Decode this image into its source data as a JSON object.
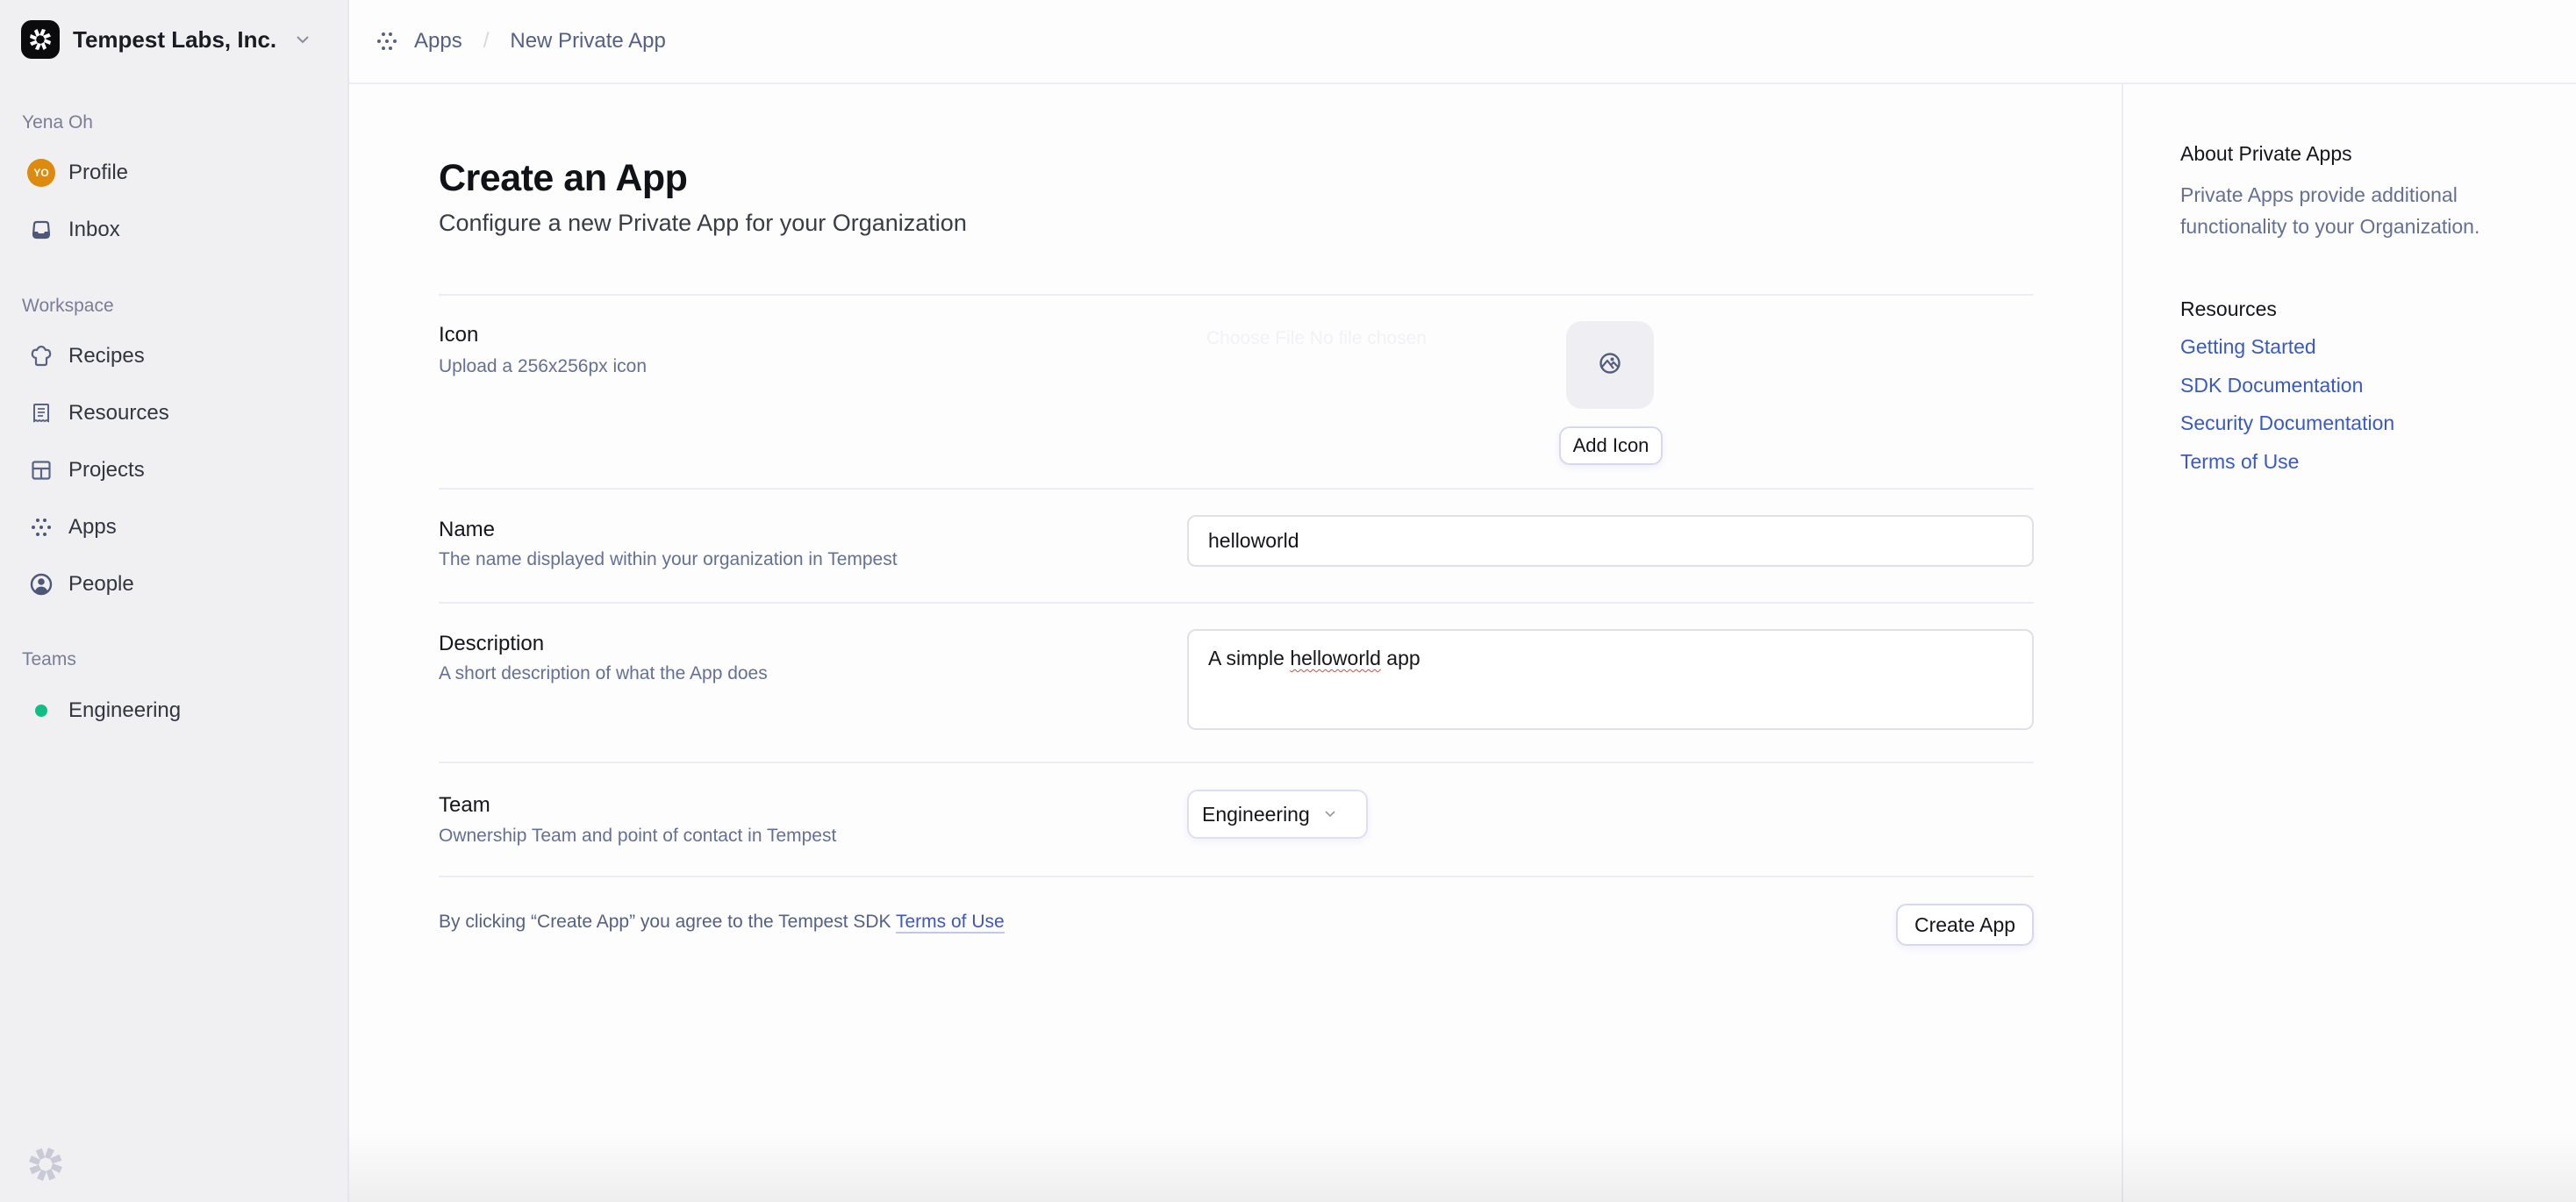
{
  "sidebar": {
    "org_name": "Tempest Labs, Inc.",
    "user_section_label": "Yena Oh",
    "user_items": [
      {
        "label": "Profile",
        "icon": "avatar",
        "avatar_initials": "YO",
        "avatar_color": "#dd8a0d"
      },
      {
        "label": "Inbox",
        "icon": "inbox-icon"
      }
    ],
    "workspace_section_label": "Workspace",
    "workspace_items": [
      {
        "label": "Recipes",
        "icon": "chef-hat-icon"
      },
      {
        "label": "Resources",
        "icon": "receipt-icon"
      },
      {
        "label": "Projects",
        "icon": "layout-icon"
      },
      {
        "label": "Apps",
        "icon": "dots-grid-icon"
      },
      {
        "label": "People",
        "icon": "user-circle-icon"
      }
    ],
    "teams_section_label": "Teams",
    "teams": [
      {
        "label": "Engineering",
        "color": "#10be84"
      }
    ]
  },
  "header": {
    "breadcrumb": [
      {
        "label": "Apps",
        "icon": "dots-grid-icon"
      },
      {
        "label": "New Private App"
      }
    ],
    "separator": "/"
  },
  "main": {
    "title": "Create an App",
    "subtitle": "Configure a new Private App for your Organization",
    "icon_row": {
      "label": "Icon",
      "help": "Upload a 256x256px icon",
      "file_input_text": "Choose File  No file chosen",
      "button_label": "Add Icon"
    },
    "name_row": {
      "label": "Name",
      "help": "The name displayed within your organization in Tempest",
      "value": "helloworld"
    },
    "description_row": {
      "label": "Description",
      "help": "A short description of what the App does",
      "value_prefix": "A simple ",
      "value_misspelled": "helloworld",
      "value_suffix": " app"
    },
    "team_row": {
      "label": "Team",
      "help": "Ownership Team and point of contact in Tempest",
      "selected": "Engineering"
    },
    "footer": {
      "text": "By clicking “Create App” you agree to the Tempest SDK ",
      "link": "Terms of Use",
      "submit_label": "Create App"
    }
  },
  "aside": {
    "about_title": "About Private Apps",
    "about_text": "Private Apps provide additional functionality to your Organization.",
    "resources_title": "Resources",
    "links": [
      "Getting Started",
      "SDK Documentation",
      "Security Documentation",
      "Terms of Use"
    ],
    "link_color": "#3a59c4"
  }
}
